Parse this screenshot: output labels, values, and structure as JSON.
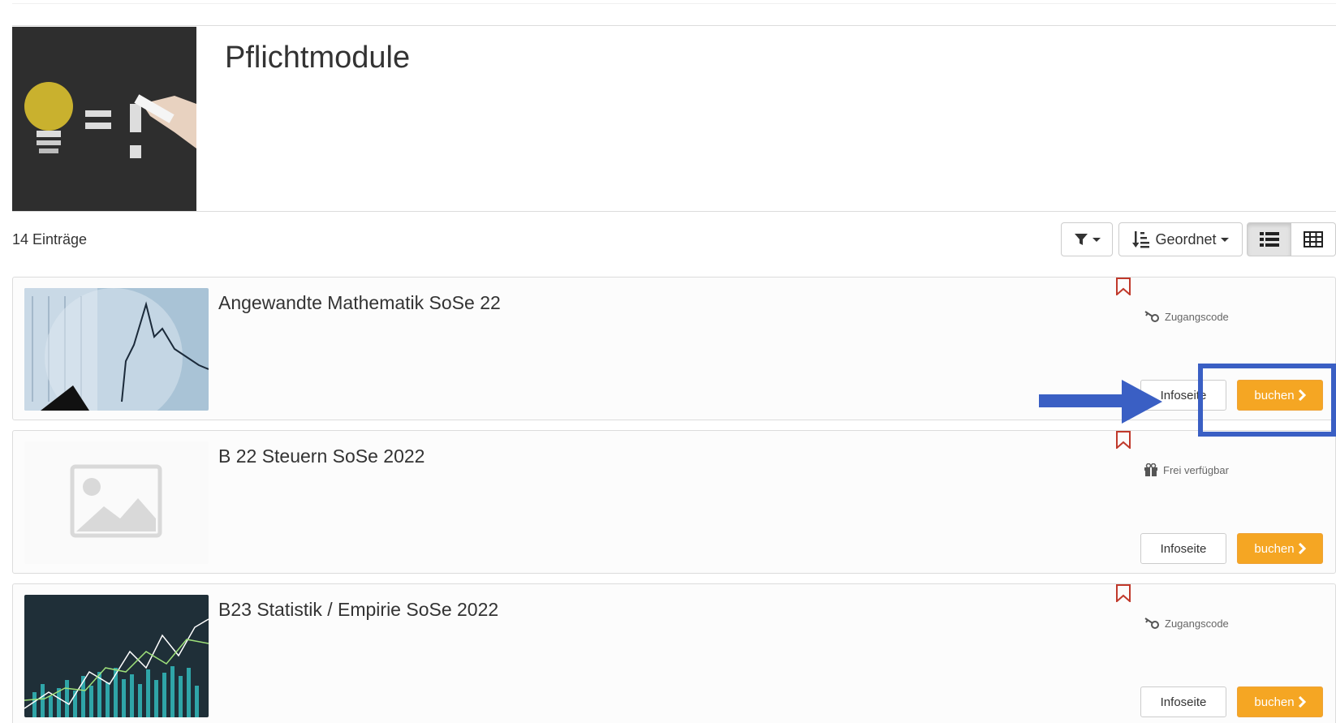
{
  "header": {
    "title": "Pflichtmodule"
  },
  "list": {
    "count_label": "14 Einträge",
    "sort_label": "Geordnet"
  },
  "items": [
    {
      "title": "Angewandte Mathematik SoSe 22",
      "meta": "Zugangscode",
      "meta_icon": "key-icon",
      "info_label": "Infoseite",
      "book_label": "buchen"
    },
    {
      "title": "B 22 Steuern SoSe 2022",
      "meta": "Frei verfügbar",
      "meta_icon": "gift-icon",
      "info_label": "Infoseite",
      "book_label": "buchen"
    },
    {
      "title": "B23 Statistik / Empirie SoSe 2022",
      "meta": "Zugangscode",
      "meta_icon": "key-icon",
      "info_label": "Infoseite",
      "book_label": "buchen"
    }
  ],
  "colors": {
    "book_button": "#f5a623",
    "highlight": "#3a5fc4",
    "bookmark": "#c0392b"
  }
}
